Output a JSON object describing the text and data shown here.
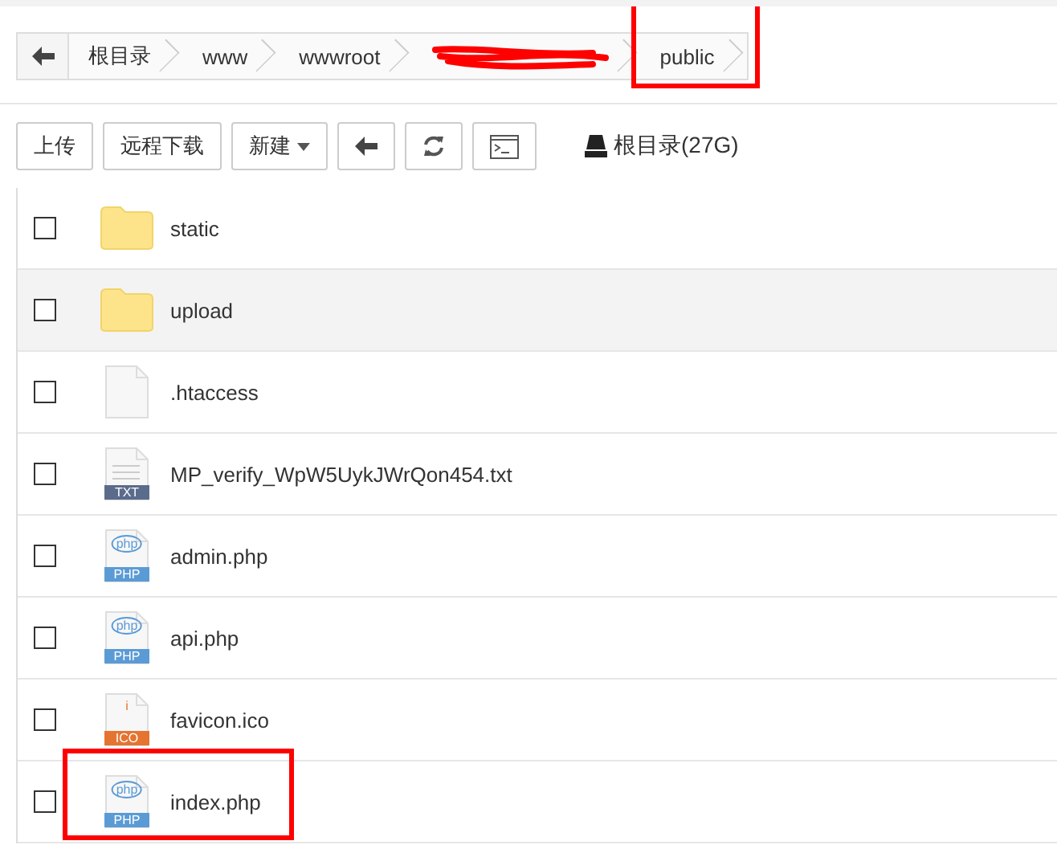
{
  "breadcrumb": [
    {
      "kind": "text",
      "label": "根目录"
    },
    {
      "kind": "text",
      "label": "www"
    },
    {
      "kind": "text",
      "label": "wwwroot"
    },
    {
      "kind": "redacted"
    },
    {
      "kind": "text",
      "label": "public",
      "highlighted": true
    }
  ],
  "toolbar": {
    "buttons": [
      {
        "kind": "text",
        "label": "上传"
      },
      {
        "kind": "text",
        "label": "远程下载"
      },
      {
        "kind": "dropdown",
        "label": "新建"
      },
      {
        "kind": "back"
      },
      {
        "kind": "refresh"
      },
      {
        "kind": "terminal"
      }
    ],
    "disk": "根目录(27G)"
  },
  "files": [
    {
      "kind": "folder",
      "name": "static",
      "checked": false,
      "hovered": false,
      "highlighted": false
    },
    {
      "kind": "folder",
      "name": "upload",
      "checked": false,
      "hovered": true,
      "highlighted": false
    },
    {
      "kind": "blank",
      "name": ".htaccess",
      "checked": false,
      "hovered": false,
      "highlighted": false
    },
    {
      "kind": "txt",
      "name": "MP_verify_WpW5UykJWrQon454.txt",
      "badge": "TXT",
      "checked": false,
      "hovered": false,
      "highlighted": false
    },
    {
      "kind": "php",
      "name": "admin.php",
      "badge": "PHP",
      "logo": "php",
      "checked": false,
      "hovered": false,
      "highlighted": false
    },
    {
      "kind": "php",
      "name": "api.php",
      "badge": "PHP",
      "logo": "php",
      "checked": false,
      "hovered": false,
      "highlighted": false
    },
    {
      "kind": "ico",
      "name": "favicon.ico",
      "badge": "ICO",
      "logo": "i",
      "checked": false,
      "hovered": false,
      "highlighted": false
    },
    {
      "kind": "php",
      "name": "index.php",
      "badge": "PHP",
      "logo": "php",
      "checked": false,
      "hovered": false,
      "highlighted": true
    }
  ]
}
